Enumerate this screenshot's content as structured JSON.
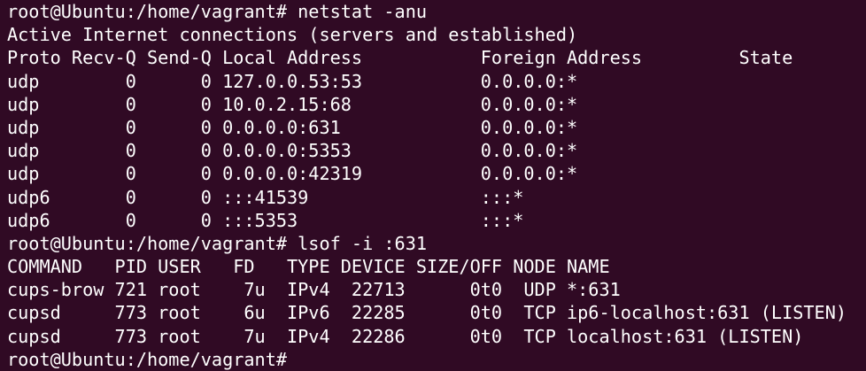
{
  "colors": {
    "background": "#300a24",
    "foreground": "#ffffff"
  },
  "terminal": {
    "lines": [
      "root@Ubuntu:/home/vagrant# netstat -anu",
      "Active Internet connections (servers and established)",
      "Proto Recv-Q Send-Q Local Address           Foreign Address         State",
      "udp        0      0 127.0.0.53:53           0.0.0.0:*",
      "udp        0      0 10.0.2.15:68            0.0.0.0:*",
      "udp        0      0 0.0.0.0:631             0.0.0.0:*",
      "udp        0      0 0.0.0.0:5353            0.0.0.0:*",
      "udp        0      0 0.0.0.0:42319           0.0.0.0:*",
      "udp6       0      0 :::41539                :::*",
      "udp6       0      0 :::5353                 :::*",
      "root@Ubuntu:/home/vagrant# lsof -i :631",
      "COMMAND   PID USER   FD   TYPE DEVICE SIZE/OFF NODE NAME",
      "cups-brow 721 root    7u  IPv4  22713      0t0  UDP *:631",
      "cupsd     773 root    6u  IPv6  22285      0t0  TCP ip6-localhost:631 (LISTEN)",
      "cupsd     773 root    7u  IPv4  22286      0t0  TCP localhost:631 (LISTEN)",
      "root@Ubuntu:/home/vagrant#"
    ]
  }
}
